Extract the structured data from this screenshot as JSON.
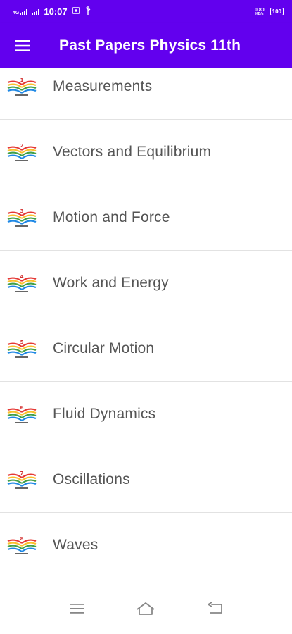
{
  "status_bar": {
    "network": "4G",
    "time": "10:07",
    "speed_top": "0.80",
    "speed_bottom": "KB/s",
    "battery": "100"
  },
  "app_bar": {
    "title": "Past Papers Physics 11th",
    "menu_icon": "hamburger-menu-icon"
  },
  "chapters": [
    {
      "number": "1",
      "label": "Measurements"
    },
    {
      "number": "2",
      "label": "Vectors and Equilibrium"
    },
    {
      "number": "3",
      "label": "Motion and Force"
    },
    {
      "number": "4",
      "label": "Work and Energy"
    },
    {
      "number": "5",
      "label": "Circular Motion"
    },
    {
      "number": "6",
      "label": "Fluid Dynamics"
    },
    {
      "number": "7",
      "label": "Oscillations"
    },
    {
      "number": "8",
      "label": "Waves"
    }
  ],
  "nav_bar": {
    "menu_icon": "recents-icon",
    "home_icon": "home-icon",
    "back_icon": "back-icon"
  },
  "colors": {
    "primary": "#6200ee",
    "text": "#555555",
    "divider": "#e2e2e2"
  }
}
